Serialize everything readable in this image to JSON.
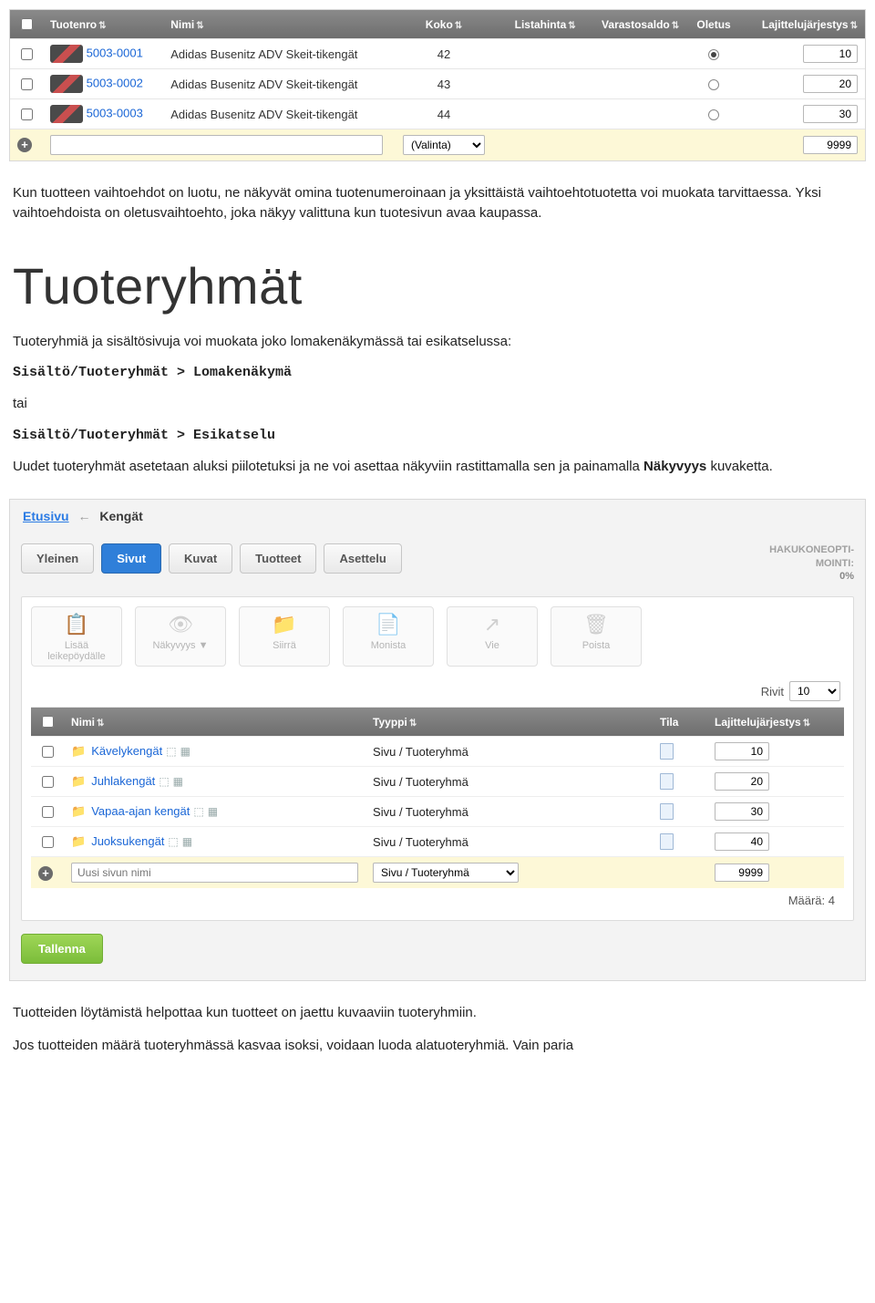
{
  "product_table": {
    "headers": {
      "tuotenro": "Tuotenro",
      "nimi": "Nimi",
      "koko": "Koko",
      "listahinta": "Listahinta",
      "varastosaldo": "Varastosaldo",
      "oletus": "Oletus",
      "lajittelu": "Lajittelujärjestys"
    },
    "rows": [
      {
        "id": "5003-0001",
        "name": "Adidas Busenitz ADV Skeit-tikengät",
        "size": "42",
        "default": true,
        "sort": "10"
      },
      {
        "id": "5003-0002",
        "name": "Adidas Busenitz ADV Skeit-tikengät",
        "size": "43",
        "default": false,
        "sort": "20"
      },
      {
        "id": "5003-0003",
        "name": "Adidas Busenitz ADV Skeit-tikengät",
        "size": "44",
        "default": false,
        "sort": "30"
      }
    ],
    "add_row": {
      "select_label": "(Valinta)",
      "sort": "9999"
    }
  },
  "text": {
    "p1": "Kun tuotteen vaihtoehdot on luotu, ne näkyvät omina tuotenumeroinaan ja yksittäistä vaihtoehtotuotetta voi muokata tarvittaessa. Yksi vaihtoehdoista on oletusvaihtoehto, joka näkyy valittuna kun tuotesivun avaa kaupassa.",
    "h1": "Tuoteryhmät",
    "p2": "Tuoteryhmiä ja sisältösivuja voi muokata joko lomakenäkymässä tai esikatselussa:",
    "path1": "Sisältö/Tuoteryhmät > Lomakenäkymä",
    "tai": "tai",
    "path2": "Sisältö/Tuoteryhmät > Esikatselu",
    "p3a": "Uudet tuoteryhmät asetetaan aluksi piilotetuksi ja ne voi asettaa näkyviin rastittamalla sen ja painamalla ",
    "p3b": "Näkyvyys",
    "p3c": " kuvaketta.",
    "p4": "Tuotteiden löytämistä helpottaa kun tuotteet on jaettu kuvaaviin tuoteryhmiin.",
    "p5": "Jos tuotteiden määrä tuoteryhmässä kasvaa isoksi, voidaan luoda alatuoteryhmiä. Vain paria"
  },
  "panel": {
    "breadcrumb": {
      "home": "Etusivu",
      "current": "Kengät"
    },
    "tabs": [
      "Yleinen",
      "Sivut",
      "Kuvat",
      "Tuotteet",
      "Asettelu"
    ],
    "active_tab": 1,
    "seo": {
      "line1": "HAKUKONEOPTI-",
      "line2": "MOINTI:",
      "pct": "0%"
    },
    "actions": [
      {
        "key": "clipboard",
        "label": "Lisää leikepöydälle",
        "glyph": "📋"
      },
      {
        "key": "visibility",
        "label": "Näkyvyys ▼",
        "glyph": "👁"
      },
      {
        "key": "move",
        "label": "Siirrä",
        "glyph": "📁"
      },
      {
        "key": "duplicate",
        "label": "Monista",
        "glyph": "📄"
      },
      {
        "key": "export",
        "label": "Vie",
        "glyph": "↗"
      },
      {
        "key": "delete",
        "label": "Poista",
        "glyph": "🗑"
      }
    ],
    "rows_label": "Rivit",
    "rows_value": "10",
    "grid_headers": {
      "nimi": "Nimi",
      "tyyppi": "Tyyppi",
      "tila": "Tila",
      "lajittelu": "Lajittelujärjestys"
    },
    "categories": [
      {
        "name": "Kävelykengät",
        "type": "Sivu / Tuoteryhmä",
        "sort": "10"
      },
      {
        "name": "Juhlakengät",
        "type": "Sivu / Tuoteryhmä",
        "sort": "20"
      },
      {
        "name": "Vapaa-ajan kengät",
        "type": "Sivu / Tuoteryhmä",
        "sort": "30"
      },
      {
        "name": "Juoksukengät",
        "type": "Sivu / Tuoteryhmä",
        "sort": "40"
      }
    ],
    "add_row": {
      "placeholder": "Uusi sivun nimi",
      "type_select": "Sivu / Tuoteryhmä",
      "sort": "9999"
    },
    "count_label": "Määrä: 4",
    "save": "Tallenna"
  }
}
